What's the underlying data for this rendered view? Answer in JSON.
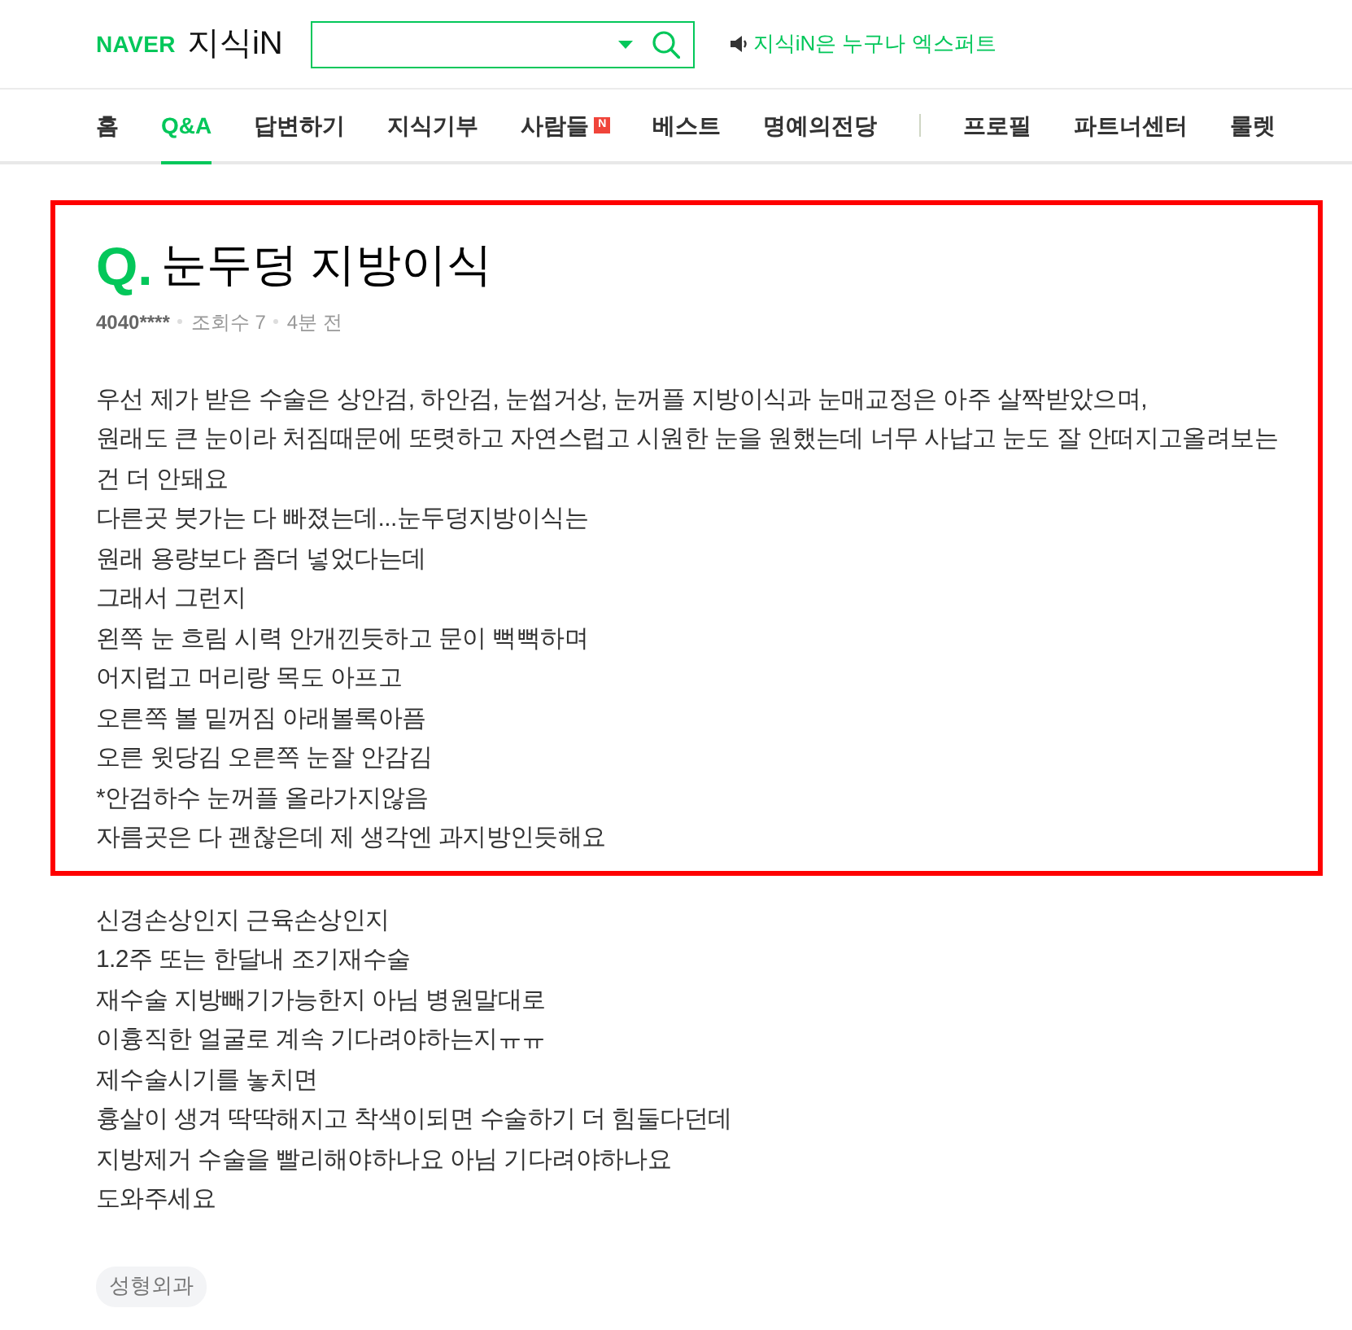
{
  "header": {
    "logo": {
      "brand": "NAVER",
      "service": "지식iN"
    },
    "notice": "지식iN은 누구나 엑스퍼트"
  },
  "nav": {
    "main_items": [
      {
        "label": "홈",
        "selected": false
      },
      {
        "label": "Q&A",
        "selected": true
      },
      {
        "label": "답변하기",
        "selected": false
      },
      {
        "label": "지식기부",
        "selected": false
      },
      {
        "label": "사람들",
        "selected": false,
        "badge": "N"
      },
      {
        "label": "베스트",
        "selected": false
      },
      {
        "label": "명예의전당",
        "selected": false
      }
    ],
    "account_items": [
      {
        "label": "프로필",
        "selected": false
      },
      {
        "label": "파트너센터",
        "selected": false
      },
      {
        "label": "룰렛",
        "selected": false
      }
    ]
  },
  "question": {
    "prefix": "Q.",
    "title": "눈두덩 지방이식",
    "author": "4040****",
    "views": "조회수 7",
    "time": "4분 전",
    "highlighted_lines": [
      "우선 제가 받은 수술은 상안검, 하안검, 눈썹거상, 눈꺼플 지방이식과 눈매교정은 아주 살짝받았으며,",
      "원래도 큰 눈이라 처짐때문에 또렷하고 자연스럽고 시원한 눈을 원했는데 너무 사납고 눈도 잘 안떠지고올려보는건 더 안돼요",
      "다른곳 붓가는 다 빠졌는데...눈두덩지방이식는",
      "원래 용량보다 좀더 넣었다는데",
      "그래서 그런지",
      "왼쪽 눈 흐림 시력 안개낀듯하고 문이 뻑뻑하며",
      "어지럽고 머리랑 목도 아프고",
      "오른쪽 볼 밑꺼짐 아래볼록아픔",
      "오른 윗당김 오른쪽 눈잘 안감김",
      "*안검하수 눈꺼플 올라가지않음",
      "자름곳은 다 괜찮은데 제 생각엔 과지방인듯해요"
    ],
    "lines": [
      "신경손상인지 근육손상인지",
      "1.2주 또는 한달내 조기재수술",
      "재수술 지방빼기가능한지 아님 병원말대로",
      "이흉직한 얼굴로 계속 기다려야하는지ㅠㅠ",
      "제수술시기를 놓치면",
      "흉살이 생겨 딱딱해지고 착색이되면 수술하기 더 힘둘다던데",
      "지방제거 수술을 빨리해야하나요 아님 기다려야하나요",
      "도와주세요"
    ],
    "tags": [
      "성형외과"
    ]
  }
}
